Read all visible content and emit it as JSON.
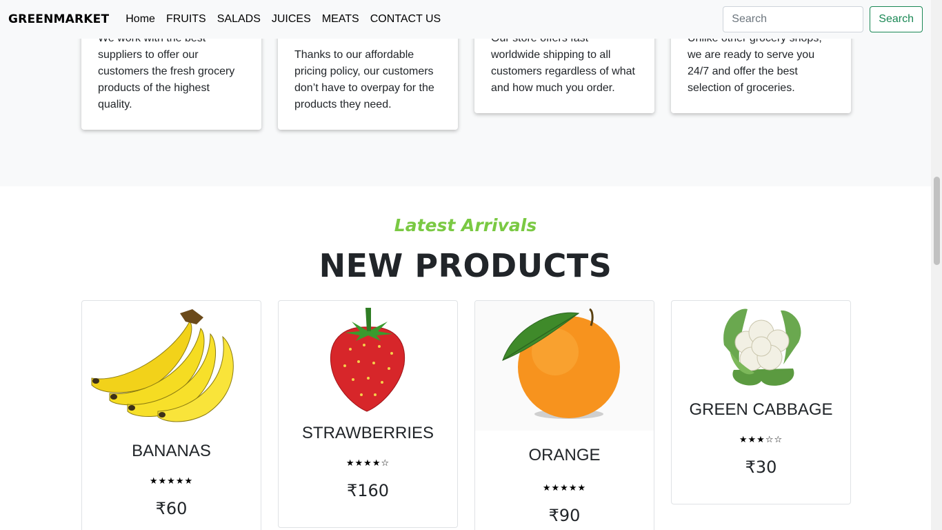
{
  "navbar": {
    "brand": "GREENMARKET",
    "links": [
      "Home",
      "FRUITS",
      "SALADS",
      "JUICES",
      "MEATS",
      "CONTACT US"
    ],
    "search_placeholder": "Search",
    "search_button": "Search"
  },
  "features": [
    {
      "text": "We work with the best suppliers to offer our customers the fresh grocery products of the highest quality."
    },
    {
      "text": "Thanks to our affordable pricing policy, our customers don’t have to overpay for the products they need."
    },
    {
      "text": "Our store offers fast worldwide shipping to all customers regardless of what and how much you order."
    },
    {
      "text": "Unlike other grocery shops, we are ready to serve you 24/7 and offer the best selection of groceries."
    }
  ],
  "new_products": {
    "eyebrow": "Latest Arrivals",
    "heading": "NEW PRODUCTS",
    "items": [
      {
        "name": "BANANAS",
        "rating": 5,
        "stars": "★★★★★",
        "price": "₹60"
      },
      {
        "name": "STRAWBERRIES",
        "rating": 4,
        "stars": "★★★★☆",
        "price": "₹160"
      },
      {
        "name": "ORANGE",
        "rating": 5,
        "stars": "★★★★★",
        "price": "₹90"
      },
      {
        "name": "GREEN CABBAGE",
        "rating": 3,
        "stars": "★★★☆☆",
        "price": "₹30"
      }
    ]
  },
  "colors": {
    "accent_green": "#7ac943",
    "button_green": "#198754",
    "section_bg": "#f8f9fa"
  }
}
